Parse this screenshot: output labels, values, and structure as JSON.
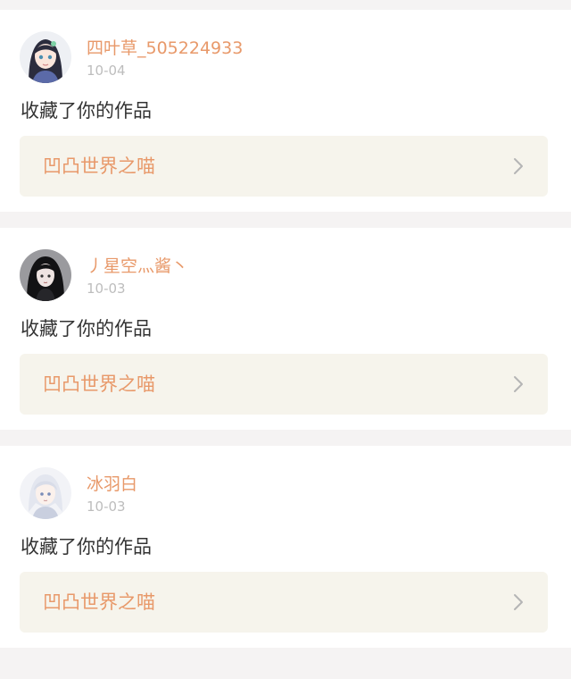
{
  "feed": {
    "items": [
      {
        "username": "四叶草_505224933",
        "date": "10-04",
        "action": "收藏了你的作品",
        "work_title": "凹凸世界之喵",
        "avatar_icon": "anime-girl-dark-hair-avatar"
      },
      {
        "username": "丿星空灬酱丶",
        "date": "10-03",
        "action": "收藏了你的作品",
        "work_title": "凹凸世界之喵",
        "avatar_icon": "anime-girl-long-black-hair-avatar"
      },
      {
        "username": "冰羽白",
        "date": "10-03",
        "action": "收藏了你的作品",
        "work_title": "凹凸世界之喵",
        "avatar_icon": "anime-boy-white-hair-avatar"
      }
    ]
  },
  "colors": {
    "accent": "#e8996a",
    "date_gray": "#bdbdbd",
    "link_background": "#f6f4ec",
    "page_background": "#f5f3f3"
  }
}
